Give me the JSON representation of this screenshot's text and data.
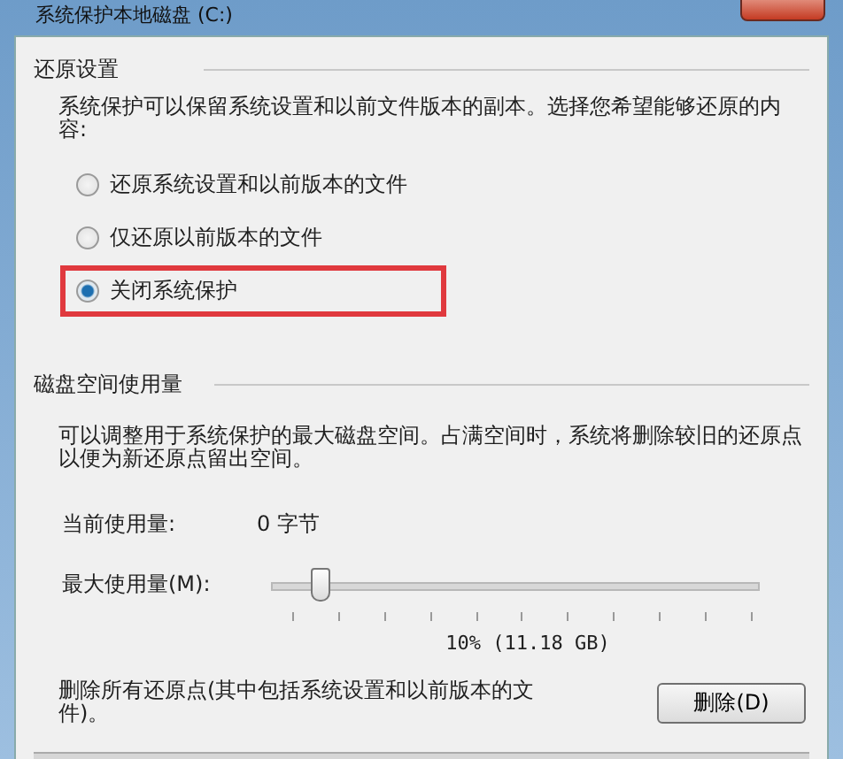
{
  "window": {
    "title": "系统保护本地磁盘 (C:)"
  },
  "restore_settings": {
    "heading": "还原设置",
    "description": "系统保护可以保留系统设置和以前文件版本的副本。选择您希望能够还原的内容:",
    "options": [
      {
        "label": "还原系统设置和以前版本的文件",
        "selected": false,
        "highlighted": false
      },
      {
        "label": "仅还原以前版本的文件",
        "selected": false,
        "highlighted": false
      },
      {
        "label": "关闭系统保护",
        "selected": true,
        "highlighted": true
      }
    ]
  },
  "disk_usage": {
    "heading": "磁盘空间使用量",
    "description": "可以调整用于系统保护的最大磁盘空间。占满空间时，系统将删除较旧的还原点以便为新还原点留出空间。",
    "current_label": "当前使用量:",
    "current_value": "0 字节",
    "max_label": "最大使用量(M):",
    "level": 0.1,
    "reading": "10% (11.18 GB)",
    "delete_text": "删除所有还原点(其中包括系统设置和以前版本的文件)。",
    "delete_button": "删除(D)"
  }
}
